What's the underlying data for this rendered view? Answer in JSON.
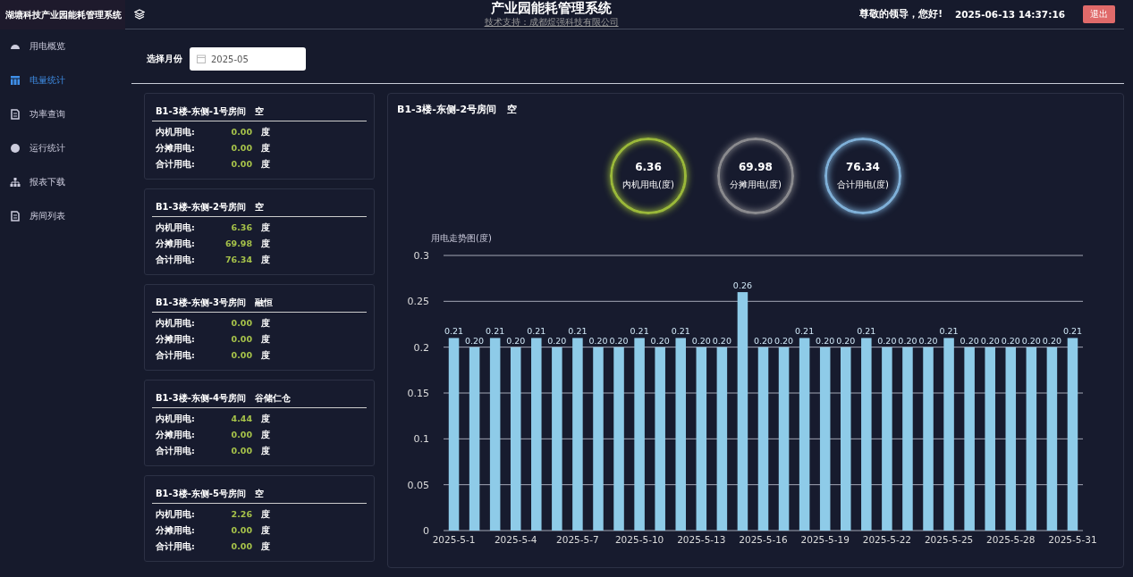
{
  "sidebar": {
    "title": "湖塘科技产业园能耗管理系统",
    "items": [
      {
        "label": "用电概览",
        "selected": false
      },
      {
        "label": "电量统计",
        "selected": true
      },
      {
        "label": "功率查询",
        "selected": false
      },
      {
        "label": "运行统计",
        "selected": false
      },
      {
        "label": "报表下载",
        "selected": false
      },
      {
        "label": "房间列表",
        "selected": false
      }
    ]
  },
  "header": {
    "title": "产业园能耗管理系统",
    "subtitle": "技术支持：成都煜强科技有限公司",
    "greeting": "尊敬的领导，您好!",
    "datetime": "2025-06-13 14:37:16",
    "logout": "退出"
  },
  "month_filter": {
    "label": "选择月份",
    "value": "2025-05"
  },
  "rooms": [
    {
      "name": "B1-3楼-东侧-1号房间",
      "tenant": "空",
      "rows": [
        {
          "label": "内机用电:",
          "value": "0.00",
          "unit": "度"
        },
        {
          "label": "分摊用电:",
          "value": "0.00",
          "unit": "度"
        },
        {
          "label": "合计用电:",
          "value": "0.00",
          "unit": "度"
        }
      ]
    },
    {
      "name": "B1-3楼-东侧-2号房间",
      "tenant": "空",
      "rows": [
        {
          "label": "内机用电:",
          "value": "6.36",
          "unit": "度"
        },
        {
          "label": "分摊用电:",
          "value": "69.98",
          "unit": "度"
        },
        {
          "label": "合计用电:",
          "value": "76.34",
          "unit": "度"
        }
      ]
    },
    {
      "name": "B1-3楼-东侧-3号房间",
      "tenant": "融恒",
      "rows": [
        {
          "label": "内机用电:",
          "value": "0.00",
          "unit": "度"
        },
        {
          "label": "分摊用电:",
          "value": "0.00",
          "unit": "度"
        },
        {
          "label": "合计用电:",
          "value": "0.00",
          "unit": "度"
        }
      ]
    },
    {
      "name": "B1-3楼-东侧-4号房间",
      "tenant": "谷储仁仓",
      "rows": [
        {
          "label": "内机用电:",
          "value": "4.44",
          "unit": "度"
        },
        {
          "label": "分摊用电:",
          "value": "0.00",
          "unit": "度"
        },
        {
          "label": "合计用电:",
          "value": "0.00",
          "unit": "度"
        }
      ]
    },
    {
      "name": "B1-3楼-东侧-5号房间",
      "tenant": "空",
      "rows": [
        {
          "label": "内机用电:",
          "value": "2.26",
          "unit": "度"
        },
        {
          "label": "分摊用电:",
          "value": "0.00",
          "unit": "度"
        },
        {
          "label": "合计用电:",
          "value": "0.00",
          "unit": "度"
        }
      ]
    }
  ],
  "detail": {
    "title": "B1-3楼-东侧-2号房间",
    "tenant": "空",
    "gauges": [
      {
        "value": "6.36",
        "label": "内机用电(度)",
        "color": "#9ab83a"
      },
      {
        "value": "69.98",
        "label": "分摊用电(度)",
        "color": "#8a8a8e"
      },
      {
        "value": "76.34",
        "label": "合计用电(度)",
        "color": "#7fb0d8"
      }
    ],
    "chart_data": {
      "type": "bar",
      "title": "用电走势图(度)",
      "categories": [
        "2025-5-1",
        null,
        null,
        "2025-5-4",
        null,
        null,
        "2025-5-7",
        null,
        null,
        "2025-5-10",
        null,
        null,
        "2025-5-13",
        null,
        null,
        "2025-5-16",
        null,
        null,
        "2025-5-19",
        null,
        null,
        "2025-5-22",
        null,
        null,
        "2025-5-25",
        null,
        null,
        "2025-5-28",
        null,
        null,
        "2025-5-31"
      ],
      "series": [
        {
          "color": "#8ecbe8",
          "values": [
            0.21,
            0.2,
            0.21,
            0.2,
            0.21,
            0.2,
            0.21,
            0.2,
            0.2,
            0.21,
            0.2,
            0.21,
            0.2,
            0.2,
            0.26,
            0.2,
            0.2,
            0.21,
            0.2,
            0.2,
            0.21,
            0.2,
            0.2,
            0.2,
            0.21,
            0.2,
            0.2,
            0.2,
            0.2,
            0.2,
            0.21
          ]
        }
      ],
      "value_labels": [
        "0.21",
        "0.20",
        "0.21",
        "0.20",
        "0.21",
        "0.20",
        "0.21",
        "0.20",
        "0.20",
        "0.21",
        "0.20",
        "0.21",
        "0.20",
        "0.20",
        "0.26",
        "0.20",
        "0.20",
        "0.21",
        "0.20",
        "0.20",
        "0.21",
        "0.20",
        "0.20",
        "0.20",
        "0.21",
        "0.20",
        "0.20",
        "0.20",
        "0.20",
        "0.20",
        "0.21"
      ],
      "ylim": [
        0,
        0.3
      ],
      "yticks": [
        0,
        0.05,
        0.1,
        0.15,
        0.2,
        0.25,
        0.3
      ],
      "grid": true
    }
  }
}
